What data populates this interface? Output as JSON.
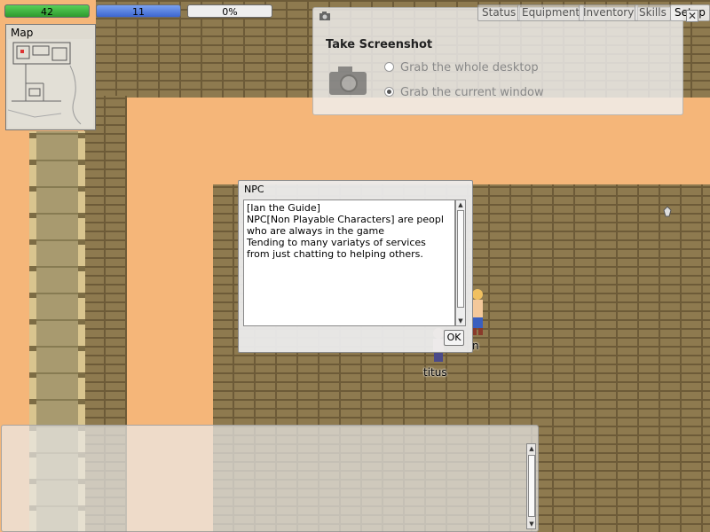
{
  "hud": {
    "hp_value": "42",
    "hp_fraction": 1.0,
    "mp_value": "11",
    "mp_fraction": 1.0,
    "xp_value": "0%",
    "xp_fraction": 0.0
  },
  "menu": {
    "status": "Status",
    "equipment": "Equipment",
    "inventory": "Inventory",
    "skills": "Skills",
    "setup": "Setup"
  },
  "minimap": {
    "title": "Map"
  },
  "screenshot_window": {
    "title": "Take Screenshot",
    "option_desktop": "Grab the whole desktop",
    "option_window": "Grab the current window",
    "selected": "window"
  },
  "npc_dialog": {
    "title": "NPC",
    "lines": [
      "[Ian the Guide]",
      "NPC[Non Playable Characters] are peopl",
      "who are always in the game",
      "Tending to many variatys of services",
      "from just chatting to helping others."
    ],
    "ok_label": "OK"
  },
  "characters": {
    "player_name": "titus",
    "npc_name_fragment": "n"
  },
  "colors": {
    "hp": "#3fb83f",
    "mp": "#5a82e0",
    "sand": "#f5b679",
    "brick": "#8e7a4f"
  }
}
